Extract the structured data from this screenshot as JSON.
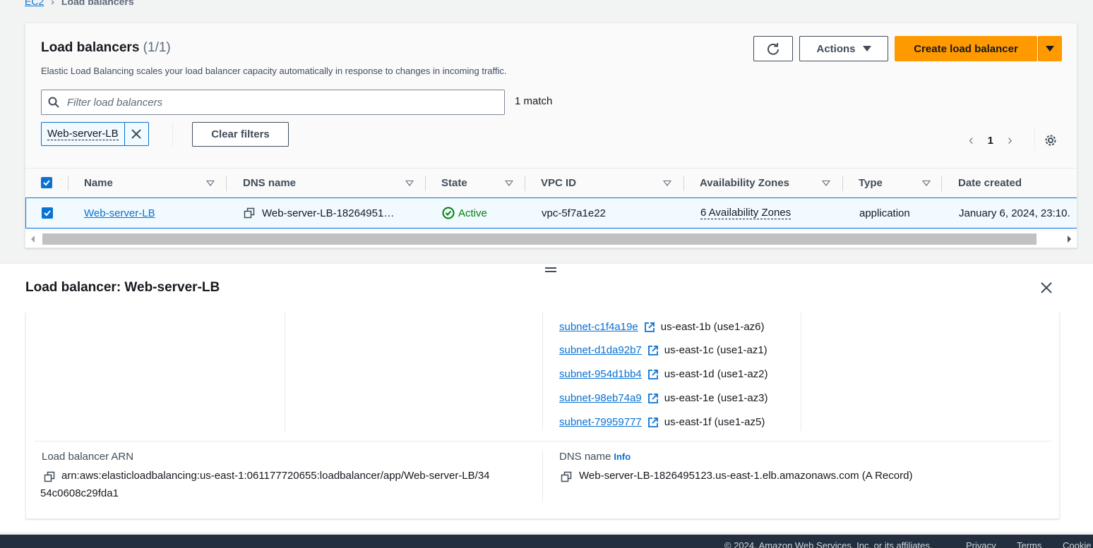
{
  "breadcrumb": {
    "root": "EC2",
    "current": "Load balancers"
  },
  "panel": {
    "title": "Load balancers",
    "count": "(1/1)",
    "description": "Elastic Load Balancing scales your load balancer capacity automatically in response to changes in incoming traffic.",
    "actions_label": "Actions",
    "create_label": "Create load balancer",
    "filter_placeholder": "Filter load balancers",
    "match_text": "1 match",
    "token_label": "Web-server-LB",
    "clear_filters_label": "Clear filters",
    "page_number": "1"
  },
  "table": {
    "columns": [
      "Name",
      "DNS name",
      "State",
      "VPC ID",
      "Availability Zones",
      "Type",
      "Date created"
    ],
    "row": {
      "name": "Web-server-LB",
      "dns": "Web-server-LB-18264951…",
      "state": "Active",
      "vpc": "vpc-5f7a1e22",
      "azs": "6 Availability Zones",
      "type": "application",
      "date": "January 6, 2024, 23:10."
    }
  },
  "details": {
    "title": "Load balancer: Web-server-LB",
    "subnets": [
      {
        "id": "subnet-c1f4a19e",
        "zone": "us-east-1b (use1-az6)"
      },
      {
        "id": "subnet-d1da92b7",
        "zone": "us-east-1c (use1-az1)"
      },
      {
        "id": "subnet-954d1bb4",
        "zone": "us-east-1d (use1-az2)"
      },
      {
        "id": "subnet-98eb74a9",
        "zone": "us-east-1e (use1-az3)"
      },
      {
        "id": "subnet-79959777",
        "zone": "us-east-1f (use1-az5)"
      }
    ],
    "arn_label": "Load balancer ARN",
    "arn_line1": "arn:aws:elasticloadbalancing:us-east-1:061177720655:loadbalancer/app/Web-server-LB/34",
    "arn_line2": "54c0608c29fda1",
    "dns_label": "DNS name",
    "dns_info": "Info",
    "dns_value": "Web-server-LB-1826495123.us-east-1.elb.amazonaws.com (A Record)"
  },
  "footer": {
    "copyright": "© 2024, Amazon Web Services, Inc. or its affiliates.",
    "privacy": "Privacy",
    "terms": "Terms",
    "cookie": "Cookie"
  },
  "colors": {
    "accent": "#0972d3",
    "primary_button": "#ff9900",
    "success": "#037f0c",
    "footer_bg": "#232f3e"
  },
  "icons": [
    "refresh-icon",
    "caret-down-icon",
    "search-icon",
    "close-icon",
    "chevron-left-icon",
    "chevron-right-icon",
    "gear-icon",
    "copy-icon",
    "check-circle-icon",
    "external-link-icon"
  ]
}
